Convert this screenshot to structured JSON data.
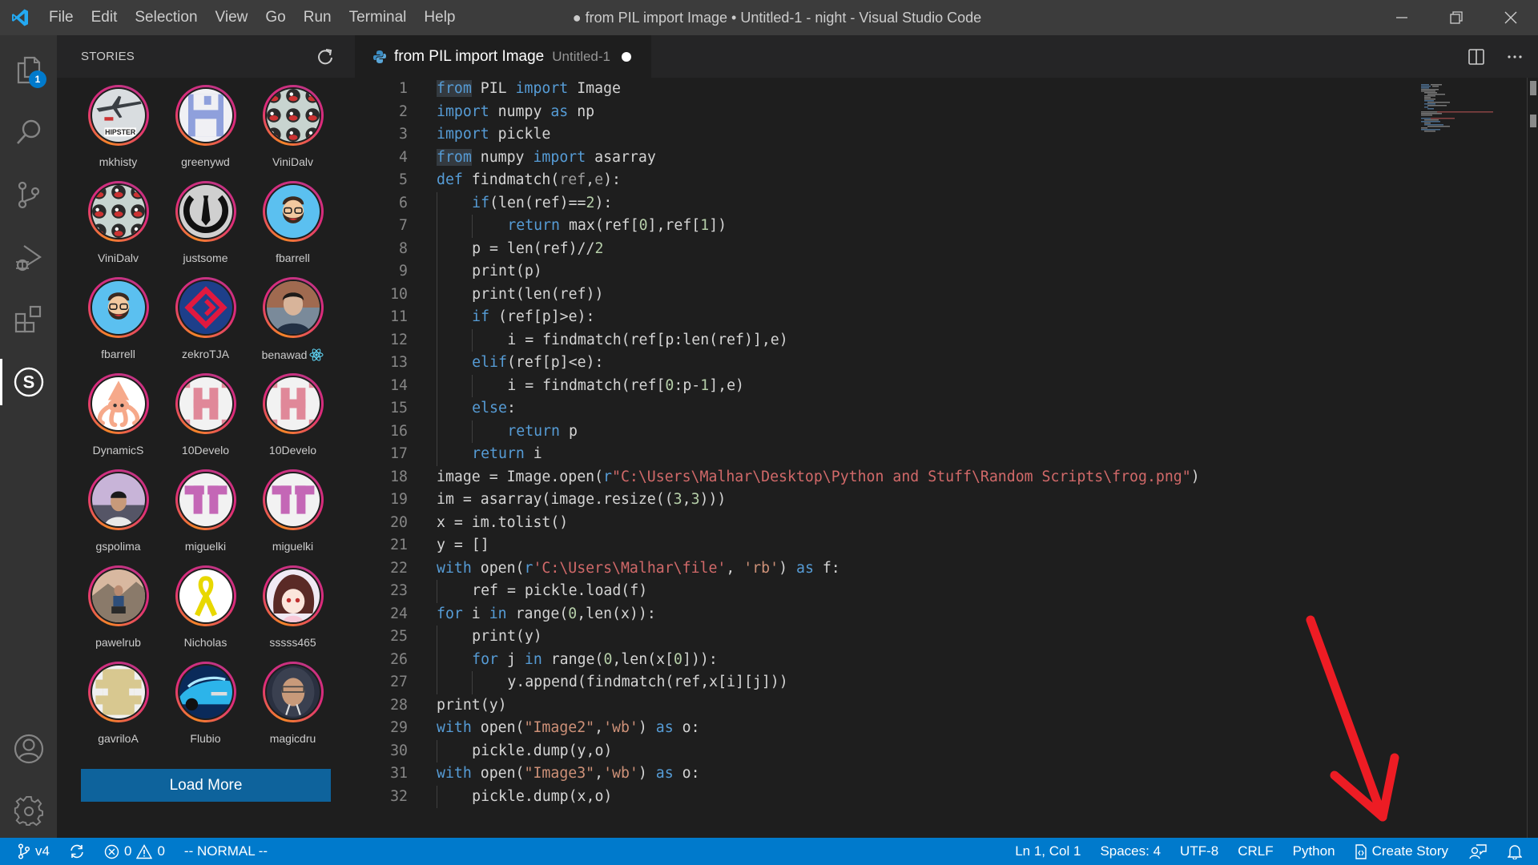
{
  "titlebar": {
    "menu": [
      "File",
      "Edit",
      "Selection",
      "View",
      "Go",
      "Run",
      "Terminal",
      "Help"
    ],
    "window_title": "● from PIL import Image • Untitled-1 - night - Visual Studio Code"
  },
  "activitybar": {
    "items": [
      {
        "name": "explorer",
        "badge": "1"
      },
      {
        "name": "search"
      },
      {
        "name": "source-control"
      },
      {
        "name": "run-debug"
      },
      {
        "name": "extensions"
      },
      {
        "name": "stories",
        "active": true
      }
    ],
    "bottom": [
      {
        "name": "accounts"
      },
      {
        "name": "manage"
      }
    ]
  },
  "sidebar": {
    "title": "STORIES",
    "stories": [
      {
        "user": "mkhisty",
        "avatar": "plane-hipster"
      },
      {
        "user": "greenywd",
        "avatar": "floppy-blue"
      },
      {
        "user": "ViniDalv",
        "avatar": "felix-pattern"
      },
      {
        "user": "ViniDalv",
        "avatar": "felix-pattern"
      },
      {
        "user": "justsome",
        "avatar": "tie-logo"
      },
      {
        "user": "fbarrell",
        "avatar": "bearded-cartoon"
      },
      {
        "user": "fbarrell",
        "avatar": "bearded-cartoon"
      },
      {
        "user": "zekroTJA",
        "avatar": "red-diamond"
      },
      {
        "user": "benawad",
        "avatar": "photo-man",
        "suffix_icon": "react-icon"
      },
      {
        "user": "DynamicS",
        "avatar": "squid"
      },
      {
        "user": "10Develo",
        "avatar": "pink-h"
      },
      {
        "user": "10Develo",
        "avatar": "pink-h"
      },
      {
        "user": "gspolima",
        "avatar": "photo-boy"
      },
      {
        "user": "miguelki",
        "avatar": "purple-tt"
      },
      {
        "user": "miguelki",
        "avatar": "purple-tt"
      },
      {
        "user": "pawelrub",
        "avatar": "photo-mountain"
      },
      {
        "user": "Nicholas",
        "avatar": "yellow-ribbon"
      },
      {
        "user": "sssss465",
        "avatar": "anime-girl"
      },
      {
        "user": "gavriloA",
        "avatar": "beige-identicon"
      },
      {
        "user": "Flubio",
        "avatar": "blue-car"
      },
      {
        "user": "magicdru",
        "avatar": "photo-hood"
      }
    ],
    "load_more_label": "Load More"
  },
  "editor": {
    "tab": {
      "label": "from PIL import Image",
      "description": "Untitled-1",
      "dirty": true
    },
    "lines": [
      {
        "n": "1",
        "indent": 0,
        "tokens": [
          [
            "kwhl",
            "from"
          ],
          [
            "t",
            " PIL "
          ],
          [
            "kw",
            "import"
          ],
          [
            "t",
            " Image"
          ]
        ]
      },
      {
        "n": "2",
        "indent": 0,
        "tokens": [
          [
            "kw",
            "import"
          ],
          [
            "t",
            " numpy "
          ],
          [
            "kw",
            "as"
          ],
          [
            "t",
            " np"
          ]
        ]
      },
      {
        "n": "3",
        "indent": 0,
        "tokens": [
          [
            "kw",
            "import"
          ],
          [
            "t",
            " pickle"
          ]
        ]
      },
      {
        "n": "4",
        "indent": 0,
        "tokens": [
          [
            "kwhl",
            "from"
          ],
          [
            "t",
            " numpy "
          ],
          [
            "kw",
            "import"
          ],
          [
            "t",
            " asarray"
          ]
        ]
      },
      {
        "n": "5",
        "indent": 0,
        "tokens": [
          [
            "kw",
            "def"
          ],
          [
            "t",
            " findmatch("
          ],
          [
            "param",
            "ref"
          ],
          [
            "t",
            ","
          ],
          [
            "param",
            "e"
          ],
          [
            "t",
            "):"
          ]
        ]
      },
      {
        "n": "6",
        "indent": 1,
        "tokens": [
          [
            "kw",
            "if"
          ],
          [
            "t",
            "(len(ref)=="
          ],
          [
            "num",
            "2"
          ],
          [
            "t",
            "):"
          ]
        ]
      },
      {
        "n": "7",
        "indent": 2,
        "tokens": [
          [
            "kw",
            "return"
          ],
          [
            "t",
            " max(ref["
          ],
          [
            "num",
            "0"
          ],
          [
            "t",
            "],ref["
          ],
          [
            "num",
            "1"
          ],
          [
            "t",
            "])"
          ]
        ]
      },
      {
        "n": "8",
        "indent": 1,
        "tokens": [
          [
            "t",
            "p = len(ref)//"
          ],
          [
            "num",
            "2"
          ]
        ]
      },
      {
        "n": "9",
        "indent": 1,
        "tokens": [
          [
            "t",
            "print(p)"
          ]
        ]
      },
      {
        "n": "10",
        "indent": 1,
        "tokens": [
          [
            "t",
            "print(len(ref))"
          ]
        ]
      },
      {
        "n": "11",
        "indent": 1,
        "tokens": [
          [
            "kw",
            "if"
          ],
          [
            "t",
            " (ref[p]>e):"
          ]
        ]
      },
      {
        "n": "12",
        "indent": 2,
        "tokens": [
          [
            "t",
            "i = findmatch(ref[p:len(ref)],e)"
          ]
        ]
      },
      {
        "n": "13",
        "indent": 1,
        "tokens": [
          [
            "kw",
            "elif"
          ],
          [
            "t",
            "(ref[p]<e):"
          ]
        ]
      },
      {
        "n": "14",
        "indent": 2,
        "tokens": [
          [
            "t",
            "i = findmatch(ref["
          ],
          [
            "num",
            "0"
          ],
          [
            "t",
            ":p-"
          ],
          [
            "num",
            "1"
          ],
          [
            "t",
            "],e)"
          ]
        ]
      },
      {
        "n": "15",
        "indent": 1,
        "tokens": [
          [
            "kw",
            "else"
          ],
          [
            "t",
            ":"
          ]
        ]
      },
      {
        "n": "16",
        "indent": 2,
        "tokens": [
          [
            "kw",
            "return"
          ],
          [
            "t",
            " p"
          ]
        ]
      },
      {
        "n": "17",
        "indent": 1,
        "tokens": [
          [
            "kw",
            "return"
          ],
          [
            "t",
            " i"
          ]
        ]
      },
      {
        "n": "18",
        "indent": 0,
        "tokens": [
          [
            "t",
            "image = Image.open("
          ],
          [
            "kw",
            "r"
          ],
          [
            "rstr",
            "\"C:\\Users\\Malhar\\Desktop\\Python and Stuff\\Random Scripts\\frog.png\""
          ],
          [
            "t",
            ")"
          ]
        ]
      },
      {
        "n": "19",
        "indent": 0,
        "tokens": [
          [
            "t",
            "im = asarray(image.resize(("
          ],
          [
            "num",
            "3"
          ],
          [
            "t",
            ","
          ],
          [
            "num",
            "3"
          ],
          [
            "t",
            ")))"
          ]
        ]
      },
      {
        "n": "20",
        "indent": 0,
        "tokens": [
          [
            "t",
            "x = im.tolist()"
          ]
        ]
      },
      {
        "n": "21",
        "indent": 0,
        "tokens": [
          [
            "t",
            "y = []"
          ]
        ]
      },
      {
        "n": "22",
        "indent": 0,
        "tokens": [
          [
            "kw",
            "with"
          ],
          [
            "t",
            " open("
          ],
          [
            "kw",
            "r"
          ],
          [
            "rstr",
            "'C:\\Users\\Malhar\\file'"
          ],
          [
            "t",
            ", "
          ],
          [
            "str",
            "'rb'"
          ],
          [
            "t",
            ") "
          ],
          [
            "kw",
            "as"
          ],
          [
            "t",
            " f:"
          ]
        ]
      },
      {
        "n": "23",
        "indent": 1,
        "tokens": [
          [
            "t",
            "ref = pickle.load(f)"
          ]
        ]
      },
      {
        "n": "24",
        "indent": 0,
        "tokens": [
          [
            "kw",
            "for"
          ],
          [
            "t",
            " i "
          ],
          [
            "kw",
            "in"
          ],
          [
            "t",
            " range("
          ],
          [
            "num",
            "0"
          ],
          [
            "t",
            ",len(x)):"
          ]
        ]
      },
      {
        "n": "25",
        "indent": 1,
        "tokens": [
          [
            "t",
            "print(y)"
          ]
        ]
      },
      {
        "n": "26",
        "indent": 1,
        "tokens": [
          [
            "kw",
            "for"
          ],
          [
            "t",
            " j "
          ],
          [
            "kw",
            "in"
          ],
          [
            "t",
            " range("
          ],
          [
            "num",
            "0"
          ],
          [
            "t",
            ",len(x["
          ],
          [
            "num",
            "0"
          ],
          [
            "t",
            "])):"
          ]
        ]
      },
      {
        "n": "27",
        "indent": 2,
        "tokens": [
          [
            "t",
            "y.append(findmatch(ref,x[i][j]))"
          ]
        ]
      },
      {
        "n": "28",
        "indent": 0,
        "tokens": [
          [
            "t",
            "print(y)"
          ]
        ]
      },
      {
        "n": "29",
        "indent": 0,
        "tokens": [
          [
            "kw",
            "with"
          ],
          [
            "t",
            " open("
          ],
          [
            "str",
            "\"Image2\""
          ],
          [
            "t",
            ","
          ],
          [
            "str",
            "'wb'"
          ],
          [
            "t",
            ") "
          ],
          [
            "kw",
            "as"
          ],
          [
            "t",
            " o:"
          ]
        ]
      },
      {
        "n": "30",
        "indent": 1,
        "tokens": [
          [
            "t",
            "pickle.dump(y,o)"
          ]
        ]
      },
      {
        "n": "31",
        "indent": 0,
        "tokens": [
          [
            "kw",
            "with"
          ],
          [
            "t",
            " open("
          ],
          [
            "str",
            "\"Image3\""
          ],
          [
            "t",
            ","
          ],
          [
            "str",
            "'wb'"
          ],
          [
            "t",
            ") "
          ],
          [
            "kw",
            "as"
          ],
          [
            "t",
            " o:"
          ]
        ]
      },
      {
        "n": "32",
        "indent": 1,
        "tokens": [
          [
            "t",
            "pickle.dump(x,o)"
          ]
        ]
      }
    ]
  },
  "statusbar": {
    "branch": "v4",
    "errors": "0",
    "warnings": "0",
    "vim_mode": "-- NORMAL --",
    "cursor": "Ln 1, Col 1",
    "indent": "Spaces: 4",
    "encoding": "UTF-8",
    "eol": "CRLF",
    "language": "Python",
    "create_story": "Create Story"
  },
  "annotation": {
    "type": "arrow",
    "color": "#ed1c24",
    "points_to": "create-story-button"
  },
  "colors": {
    "accent": "#007acc",
    "button": "#0e639c",
    "keyword": "#569cd6",
    "number": "#b5cea8",
    "string": "#ce9178",
    "raw_string": "#d16969"
  }
}
